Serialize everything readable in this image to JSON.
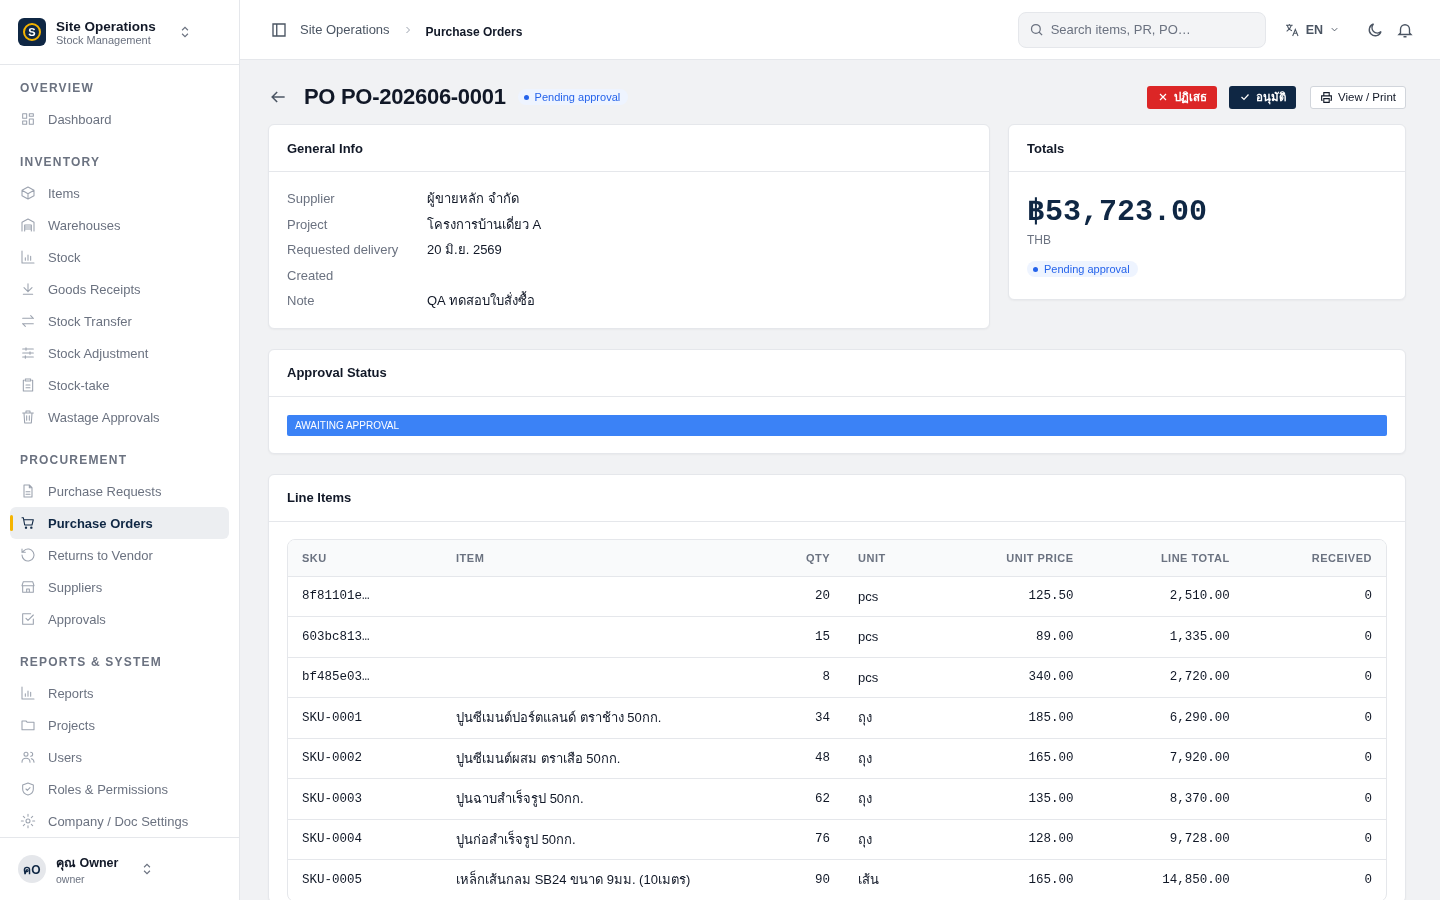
{
  "sidebar": {
    "brand": {
      "letter": "S",
      "title": "Site Operations",
      "subtitle": "Stock Management"
    },
    "sections": [
      {
        "title": "OVERVIEW",
        "items": [
          {
            "label": "Dashboard",
            "selected": false
          }
        ]
      },
      {
        "title": "INVENTORY",
        "items": [
          {
            "label": "Items",
            "selected": false
          },
          {
            "label": "Warehouses",
            "selected": false
          },
          {
            "label": "Stock",
            "selected": false
          },
          {
            "label": "Goods Receipts",
            "selected": false
          },
          {
            "label": "Stock Transfer",
            "selected": false
          },
          {
            "label": "Stock Adjustment",
            "selected": false
          },
          {
            "label": "Stock-take",
            "selected": false
          },
          {
            "label": "Wastage Approvals",
            "selected": false
          }
        ]
      },
      {
        "title": "PROCUREMENT",
        "items": [
          {
            "label": "Purchase Requests",
            "selected": false
          },
          {
            "label": "Purchase Orders",
            "selected": true
          },
          {
            "label": "Returns to Vendor",
            "selected": false
          },
          {
            "label": "Suppliers",
            "selected": false
          },
          {
            "label": "Approvals",
            "selected": false
          }
        ]
      },
      {
        "title": "REPORTS & SYSTEM",
        "items": [
          {
            "label": "Reports",
            "selected": false
          },
          {
            "label": "Projects",
            "selected": false
          },
          {
            "label": "Users",
            "selected": false
          },
          {
            "label": "Roles & Permissions",
            "selected": false
          },
          {
            "label": "Company / Doc Settings",
            "selected": false
          }
        ]
      }
    ],
    "user": {
      "initials": "คO",
      "name": "คุณ Owner",
      "role": "owner"
    }
  },
  "topbar": {
    "breadcrumb": [
      {
        "label": "Site Operations",
        "selected": false
      },
      {
        "label": "Purchase Orders",
        "selected": true
      }
    ],
    "search": {
      "placeholder": "Search items, PR, PO…"
    },
    "language": "EN"
  },
  "header": {
    "title": "PO PO-202606-0001",
    "status": {
      "label": "Pending approval",
      "color": "#2563eb"
    }
  },
  "actions": [
    {
      "label": "ปฏิเสธ",
      "kind": "danger"
    },
    {
      "label": "อนุมัติ",
      "kind": "primary"
    },
    {
      "label": "View / Print",
      "kind": "outline"
    }
  ],
  "general_info": {
    "title": "General Info",
    "fields": [
      {
        "label": "Supplier",
        "value": "ผู้ขายหลัก จำกัด"
      },
      {
        "label": "Project",
        "value": "โครงการบ้านเดี่ยว A"
      },
      {
        "label": "Requested delivery",
        "value": "20 มิ.ย. 2569"
      },
      {
        "label": "Created"
      },
      {
        "label": "Note",
        "value": "QA ทดสอบใบสั่งซื้อ"
      }
    ]
  },
  "totals": {
    "title": "Totals",
    "amount": "฿53,723.00",
    "currency": "THB",
    "status": {
      "label": "Pending approval",
      "color": "#2563eb"
    }
  },
  "approval": {
    "title": "Approval Status",
    "banner": "AWAITING APPROVAL"
  },
  "line_items": {
    "title": "Line Items",
    "columns": [
      "SKU",
      "ITEM",
      "QTY",
      "UNIT",
      "UNIT PRICE",
      "LINE TOTAL",
      "RECEIVED"
    ],
    "rows": [
      [
        "8f81101e…",
        "",
        "20",
        "pcs",
        "125.50",
        "2,510.00",
        "0"
      ],
      [
        "603bc813…",
        "",
        "15",
        "pcs",
        "89.00",
        "1,335.00",
        "0"
      ],
      [
        "bf485e03…",
        "",
        "8",
        "pcs",
        "340.00",
        "2,720.00",
        "0"
      ],
      [
        "SKU-0001",
        "ปูนซีเมนต์ปอร์ตแลนด์ ตราช้าง 50กก.",
        "34",
        "ถุง",
        "185.00",
        "6,290.00",
        "0"
      ],
      [
        "SKU-0002",
        "ปูนซีเมนต์ผสม ตราเสือ 50กก.",
        "48",
        "ถุง",
        "165.00",
        "7,920.00",
        "0"
      ],
      [
        "SKU-0003",
        "ปูนฉาบสำเร็จรูป 50กก.",
        "62",
        "ถุง",
        "135.00",
        "8,370.00",
        "0"
      ],
      [
        "SKU-0004",
        "ปูนก่อสำเร็จรูป 50กก.",
        "76",
        "ถุง",
        "128.00",
        "9,728.00",
        "0"
      ],
      [
        "SKU-0005",
        "เหล็กเส้นกลม SB24 ขนาด 9มม. (10เมตร)",
        "90",
        "เส้น",
        "165.00",
        "14,850.00",
        "0"
      ]
    ]
  }
}
